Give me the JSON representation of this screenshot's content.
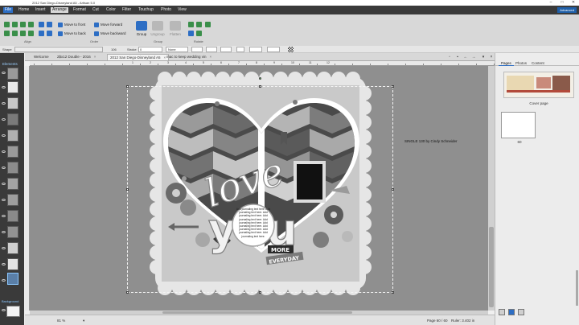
{
  "window": {
    "title": "2012 San Diego-Disneyland A5 - Artisan 5.0"
  },
  "menu": {
    "items": [
      "File",
      "Home",
      "Insert",
      "Arrange",
      "Format",
      "Cut",
      "Color",
      "Filter",
      "Touchup",
      "Photo",
      "View"
    ],
    "active": "Arrange",
    "advanced_label": "Advanced"
  },
  "ribbon": {
    "order": {
      "move_to_front": "Move to front",
      "move_to_back": "Move to back",
      "move_forward": "Move forward",
      "move_backward": "Move backward",
      "group_label": "Order"
    },
    "group": {
      "group": "Group",
      "ungroup": "Ungroup",
      "flatten": "Flatten",
      "group_label": "Group"
    },
    "align_label": "Align",
    "rotate_label": "Rotate"
  },
  "propbar": {
    "shape_label": "Shape",
    "size_value": "106",
    "stroke_label": "Stroke",
    "stroke_value": "0",
    "stroke_color": "None"
  },
  "tabs": [
    {
      "label": "Welcome",
      "active": false
    },
    {
      "label": "2$x12 Double - 2016",
      "active": false
    },
    {
      "label": "2012 San Diego-Disneyland A5",
      "active": true
    },
    {
      "label": "mac to keep wedding vin",
      "active": false
    }
  ],
  "ruler_marks": [
    "1",
    "2",
    "3",
    "4",
    "5",
    "6",
    "7",
    "8",
    "9",
    "10",
    "11",
    "12"
  ],
  "left_panel": {
    "title": "Elements",
    "background_label": "Background"
  },
  "canvas": {
    "journal_text": "Add journaling text here. Add journaling text here. Add journaling text here. Add journaling text here. Add journaling text here. Add journaling text here. Add journaling text here. Add journaling text here. Add journaling text here.",
    "word_love": "love",
    "word_you": "you",
    "more_label": "MORE",
    "everyday_label": "EVERYDAY",
    "credit": "SINGLE 130 by Cindy Schneider"
  },
  "status": {
    "zoom": "81 %",
    "page_info": "Page 60 / 60",
    "ruler_info": "Ruler: 3.402 in"
  },
  "right_panel": {
    "tabs": [
      "Pages",
      "Photos",
      "Content"
    ],
    "active_tab": "Pages",
    "cover_label": "Cover page",
    "page_number": "60"
  },
  "colors": {
    "menubar": "#3a3a3a",
    "accent": "#2d6ec4",
    "workspace": "#8f8f8f"
  }
}
